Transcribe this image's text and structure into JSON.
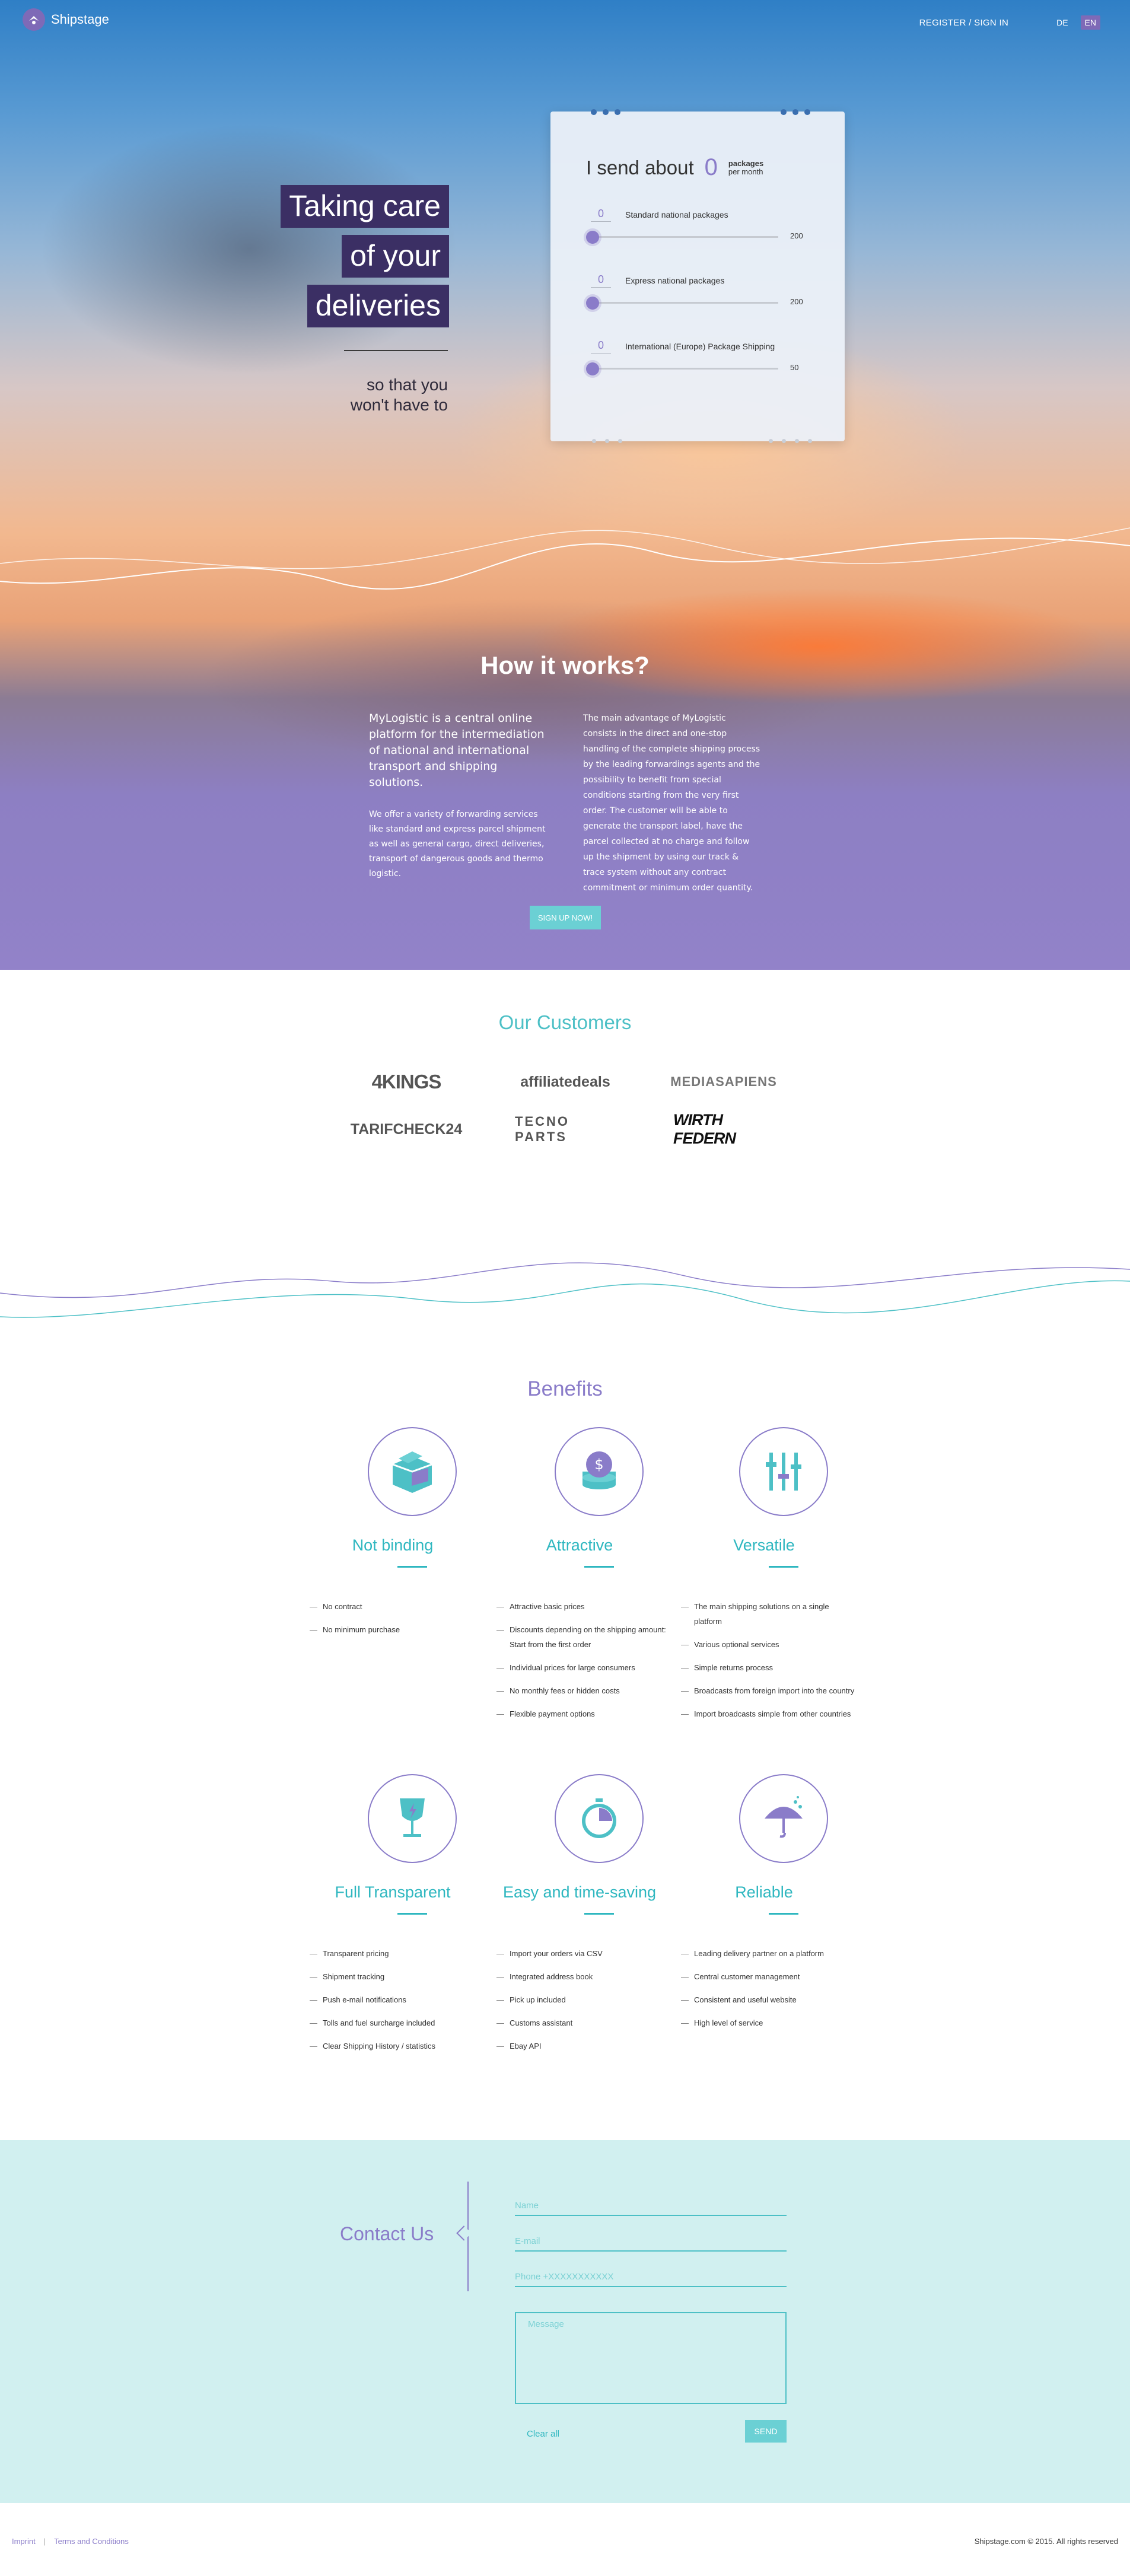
{
  "nav": {
    "logo_text": "Shipstage",
    "register_label": "REGISTER / SIGN IN",
    "languages": [
      "DE",
      "EN"
    ],
    "active_language": "EN"
  },
  "hero": {
    "tagline_lines": [
      "Taking care",
      "of your",
      "deliveries"
    ],
    "subline_lines": [
      "so that you",
      "won't have to"
    ]
  },
  "calculator": {
    "heading": "I send about",
    "total": "0",
    "unit_line1": "packages",
    "unit_line2": "per month",
    "sliders": [
      {
        "value": "0",
        "label": "Standard national packages",
        "max": "200",
        "level": 0
      },
      {
        "value": "0",
        "label": "Express national packages",
        "max": "200",
        "level": 0
      },
      {
        "value": "0",
        "label": "International (Europe) Package Shipping",
        "max": "50",
        "level": 0
      }
    ]
  },
  "how": {
    "title": "How it works?",
    "lead": "MyLogistic is a central online platform for the intermediation of national and international transport and shipping solutions.",
    "left_paragraph": "We offer a variety of forwarding services like standard and express parcel shipment as well as general cargo, direct deliveries, transport of dangerous goods and thermo logistic.",
    "right_paragraph": "The main advantage of MyLogistic consists in the direct and one-stop handling of the complete shipping process by the leading forwardings agents and the possibility to benefit from special conditions starting from the very first order. The customer will be able to generate the transport label, have the parcel collected at no charge and follow up the shipment by using our track & trace system without any contract commitment or minimum order quantity.",
    "signup_label": "SIGN UP NOW!"
  },
  "customers": {
    "title": "Our Customers",
    "logos": [
      "4KINGS",
      "affiliatedeals",
      "MEDIASAPIENS",
      "TARIFCHECK24",
      "TECNO PARTS",
      "WIRTH FEDERN"
    ]
  },
  "benefits": {
    "title": "Benefits",
    "items": [
      {
        "title": "Not binding",
        "icon": "box-icon",
        "points": [
          "No contract",
          "No minimum purchase"
        ]
      },
      {
        "title": "Attractive",
        "icon": "coins-icon",
        "points": [
          "Attractive basic prices",
          "Discounts depending on the shipping amount: Start from the first order",
          "Individual prices for large consumers",
          "No monthly fees or hidden costs",
          "Flexible payment options"
        ]
      },
      {
        "title": "Versatile",
        "icon": "sliders-icon",
        "points": [
          "The main shipping solutions on a single platform",
          "Various optional services",
          "Simple returns process",
          "Broadcasts from foreign import into the country",
          "Import broadcasts simple from other countries"
        ]
      },
      {
        "title": "Full Transparent",
        "icon": "glass-icon",
        "points": [
          "Transparent pricing",
          "Shipment tracking",
          "Push e-mail notifications",
          "Tolls and fuel surcharge included",
          "Clear Shipping History / statistics"
        ]
      },
      {
        "title": "Easy and time-saving",
        "icon": "stopwatch-icon",
        "points": [
          "Import your orders via CSV",
          "Integrated address book",
          "Pick up included",
          "Customs assistant",
          "Ebay API"
        ]
      },
      {
        "title": "Reliable",
        "icon": "umbrella-icon",
        "points": [
          "Leading delivery partner on a platform",
          "Central customer management",
          "Consistent and useful website",
          "High level of service"
        ]
      }
    ]
  },
  "contact": {
    "title": "Contact Us",
    "name_placeholder": "Name",
    "email_placeholder": "E-mail",
    "phone_placeholder": "Phone +XXXXXXXXXXX",
    "message_placeholder": "Message",
    "clear_label": "Clear all",
    "send_label": "SEND"
  },
  "footer": {
    "links": [
      "Imprint",
      "Terms and Conditions"
    ],
    "copyright": "Shipstage.com © 2015. All rights reserved"
  },
  "colors": {
    "accent_purple": "#8a7cc9",
    "accent_teal": "#4dc0c6",
    "tag_bg": "#3b2f64",
    "contact_bg": "#d1f0f0"
  }
}
